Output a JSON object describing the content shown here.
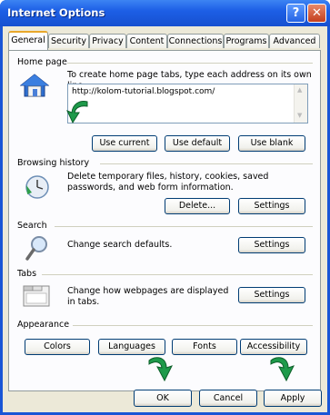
{
  "window": {
    "title": "Internet Options",
    "help_glyph": "?",
    "close_glyph": "✕"
  },
  "tabs": [
    "General",
    "Security",
    "Privacy",
    "Content",
    "Connections",
    "Programs",
    "Advanced"
  ],
  "home_page": {
    "heading": "Home page",
    "description": "To create home page tabs, type each address on its own line.",
    "url_value": "http://kolom-tutorial.blogspot.com/",
    "buttons": [
      "Use current",
      "Use default",
      "Use blank"
    ]
  },
  "browsing_history": {
    "heading": "Browsing history",
    "description": "Delete temporary files, history, cookies, saved passwords, and web form information.",
    "buttons": [
      "Delete...",
      "Settings"
    ]
  },
  "search": {
    "heading": "Search",
    "description": "Change search defaults.",
    "buttons": [
      "Settings"
    ]
  },
  "tabs_section": {
    "heading": "Tabs",
    "description": "Change how webpages are displayed in tabs.",
    "buttons": [
      "Settings"
    ]
  },
  "appearance": {
    "heading": "Appearance",
    "buttons": [
      "Colors",
      "Languages",
      "Fonts",
      "Accessibility"
    ]
  },
  "footer": {
    "ok": "OK",
    "cancel": "Cancel",
    "apply": "Apply"
  },
  "colors": {
    "titlebar": "#1d5fe6",
    "dialog_bg": "#ece9d8",
    "arrow_green": "#1e9a4a"
  }
}
